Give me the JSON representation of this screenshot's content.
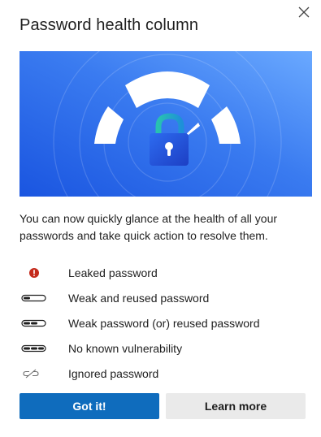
{
  "dialog": {
    "title": "Password health column",
    "close_icon": "close-icon",
    "hero_icon": "lock-gauge-illustration",
    "description": "You can now quickly glance at the health of all your passwords and take quick action to resolve them.",
    "legend": [
      {
        "icon": "leaked-alert-icon",
        "label": "Leaked password",
        "color": "#c42b1c"
      },
      {
        "icon": "strength-1-of-3-icon",
        "label": "Weak and reused password",
        "strength": 1
      },
      {
        "icon": "strength-2-of-3-icon",
        "label": "Weak password (or) reused password",
        "strength": 2
      },
      {
        "icon": "strength-3-of-3-icon",
        "label": "No known vulnerability",
        "strength": 3
      },
      {
        "icon": "broken-link-icon",
        "label": "Ignored password"
      }
    ],
    "primary_button": "Got it!",
    "secondary_button": "Learn more"
  },
  "colors": {
    "accent": "#0f6cbd",
    "hero_gradient_start": "#1a55e0",
    "hero_gradient_end": "#6aa9ff",
    "leaked": "#c42b1c"
  }
}
